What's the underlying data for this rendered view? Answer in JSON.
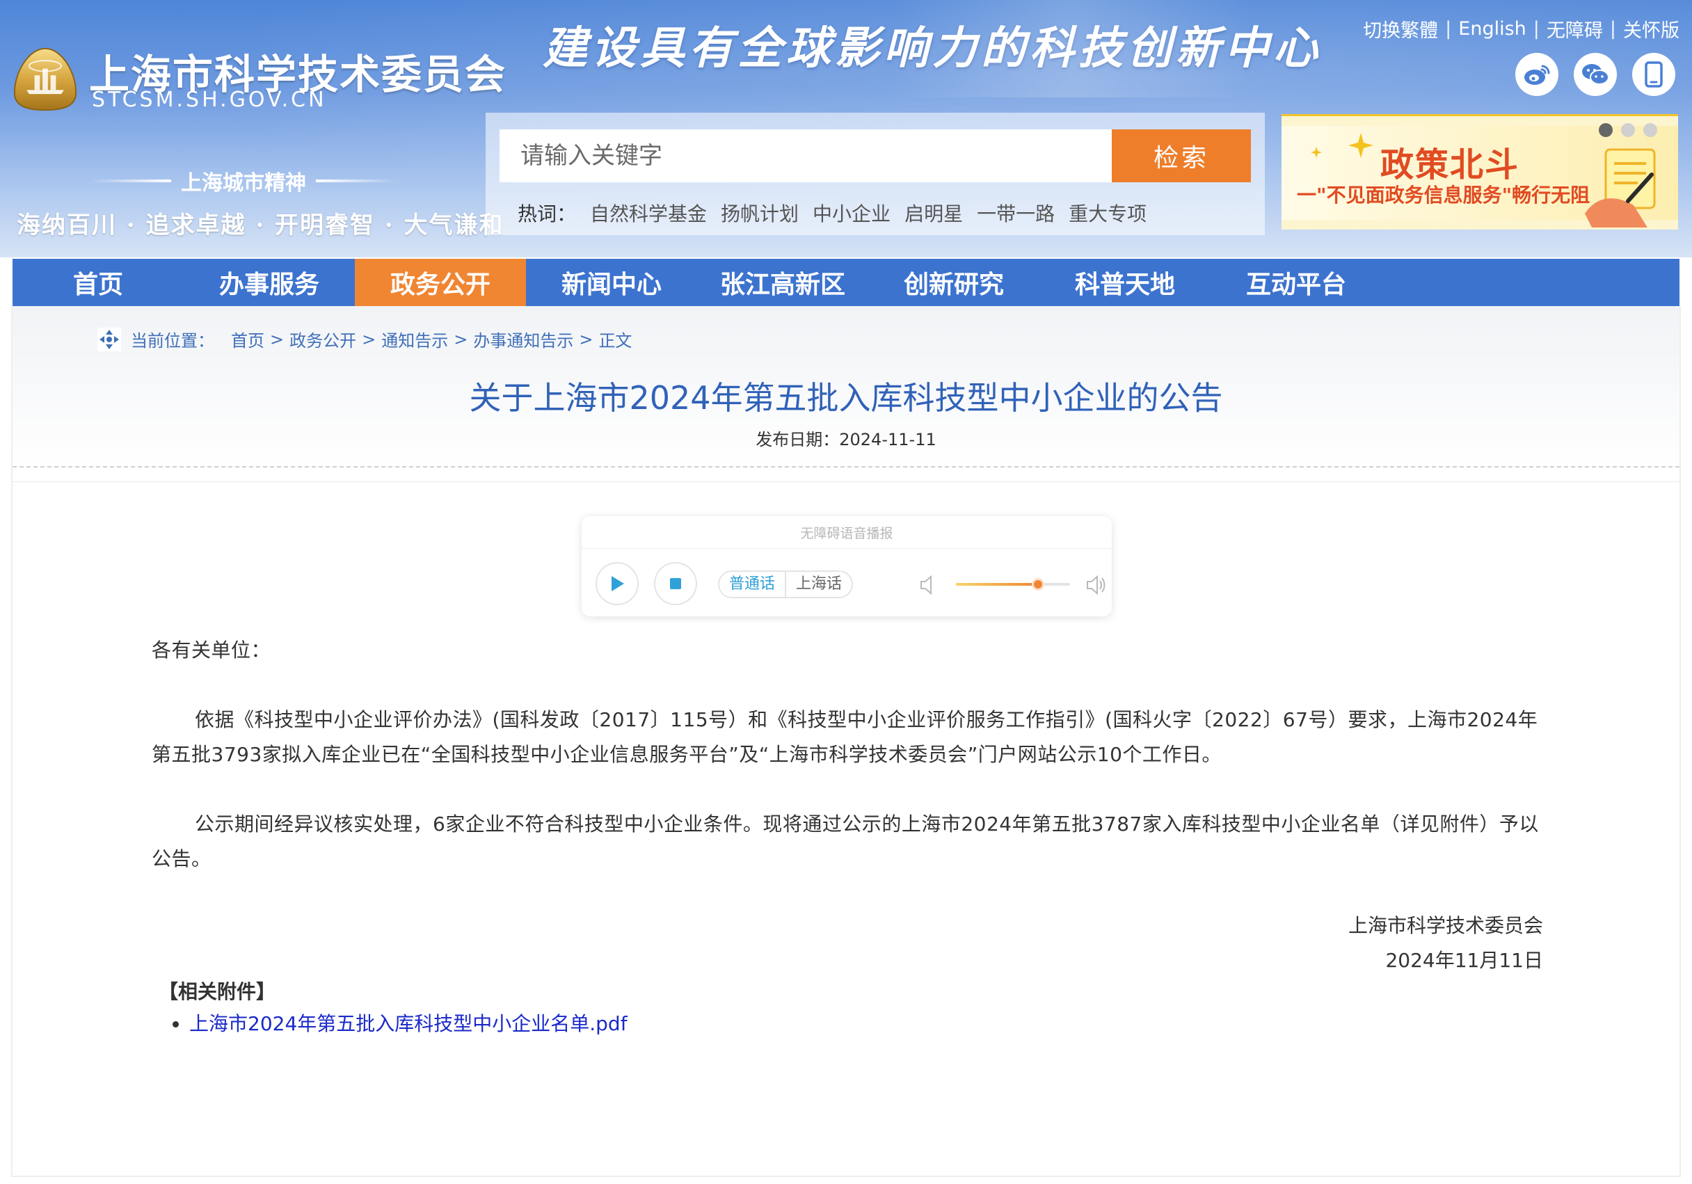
{
  "site": {
    "name": "上海市科学技术委员会",
    "domain": "STCSM.SH.GOV.CN",
    "slogan": "建设具有全球影响力的科技创新中心",
    "spirit_title": "上海城市精神",
    "spirit_text": "海纳百川 · 追求卓越 · 开明睿智 · 大气谦和"
  },
  "top_links": [
    "切换繁體",
    "English",
    "无障碍",
    "关怀版"
  ],
  "social": {
    "icons": [
      "weibo-icon",
      "wechat-icon",
      "mobile-icon"
    ]
  },
  "search": {
    "placeholder": "请输入关键字",
    "button_label": "检索",
    "hotwords_label": "热词：",
    "hotwords": [
      "自然科学基金",
      "扬帆计划",
      "中小企业",
      "启明星",
      "一带一路",
      "重大专项"
    ]
  },
  "policy_banner": {
    "title": "政策北斗",
    "subtitle": "一\"不见面政务信息服务\"畅行无阻",
    "dots_active_index": 0,
    "dots_count": 3
  },
  "nav": {
    "items": [
      "首页",
      "办事服务",
      "政务公开",
      "新闻中心",
      "张江高新区",
      "创新研究",
      "科普天地",
      "互动平台"
    ],
    "active_index": 2
  },
  "breadcrumb": {
    "label": "当前位置：",
    "items": [
      "首页",
      "政务公开",
      "通知告示",
      "办事通知告示",
      "正文"
    ],
    "separators": [
      ">",
      ">",
      ">",
      ">"
    ]
  },
  "article": {
    "title": "关于上海市2024年第五批入库科技型中小企业的公告",
    "publish_label": "发布日期：",
    "publish_date": "2024-11-11",
    "salutation": "各有关单位：",
    "paragraphs": [
      "依据《科技型中小企业评价办法》(国科发政〔2017〕115号）和《科技型中小企业评价服务工作指引》(国科火字〔2022〕67号）要求，上海市2024年第五批3793家拟入库企业已在“全国科技型中小企业信息服务平台”及“上海市科学技术委员会”门户网站公示10个工作日。",
      "公示期间经异议核实处理，6家企业不符合科技型中小企业条件。现将通过公示的上海市2024年第五批3787家入库科技型中小企业名单（详见附件）予以公告。"
    ],
    "signature_org": "上海市科学技术委员会",
    "signature_date": "2024年11月11日",
    "attachments_header": "【相关附件】",
    "attachments": [
      "上海市2024年第五批入库科技型中小企业名单.pdf"
    ]
  },
  "player": {
    "title": "无障碍语音播报",
    "languages": [
      "普通话",
      "上海话"
    ],
    "selected_language_index": 0,
    "volume": 0.72
  },
  "colors": {
    "nav_bg": "#3c73cf",
    "nav_active": "#f08532",
    "search_button": "#ef7e2a",
    "title_blue": "#3062b8",
    "link_blue": "#1a29c9"
  }
}
